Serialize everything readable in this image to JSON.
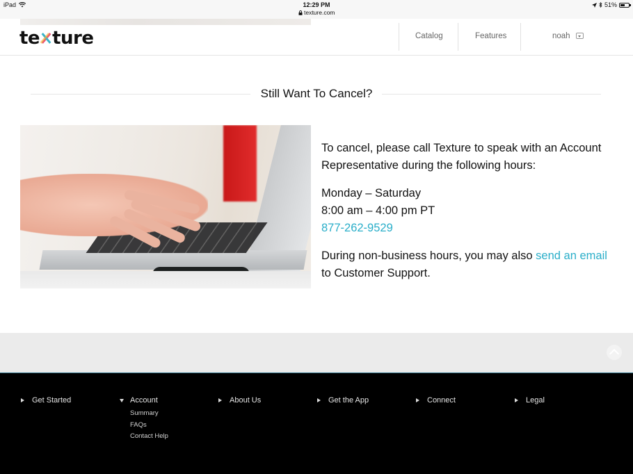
{
  "status_bar": {
    "device": "iPad",
    "time": "12:29 PM",
    "url": "texture.com",
    "battery": "51%",
    "icons": [
      "wifi-icon",
      "lock-icon",
      "location-arrow-icon",
      "bluetooth-icon",
      "battery-icon"
    ]
  },
  "header": {
    "logo_text": {
      "pre": "te",
      "post": "ture"
    },
    "nav": [
      {
        "label": "Catalog"
      },
      {
        "label": "Features"
      }
    ],
    "user": {
      "label": "noah"
    }
  },
  "section": {
    "title": "Still Want To Cancel?"
  },
  "photo": {
    "icon": "laptop-typing-photo"
  },
  "content": {
    "intro": "To cancel, please call Texture to speak with an Account Representative during the following hours:",
    "days": "Monday – Saturday",
    "hours": "8:00 am – 4:00 pm PT",
    "phone": "877-262-9529",
    "note_pre": "During non-business hours, you may also ",
    "note_link": "send an email",
    "note_post": " to Customer Support."
  },
  "footer": {
    "columns": [
      {
        "label": "Get Started",
        "expanded": false,
        "items": []
      },
      {
        "label": "Account",
        "expanded": true,
        "items": [
          "Summary",
          "FAQs",
          "Contact Help"
        ]
      },
      {
        "label": "About Us",
        "expanded": false,
        "items": []
      },
      {
        "label": "Get the App",
        "expanded": false,
        "items": []
      },
      {
        "label": "Connect",
        "expanded": false,
        "items": []
      },
      {
        "label": "Legal",
        "expanded": false,
        "items": []
      }
    ]
  },
  "colors": {
    "accent": "#2aaec9",
    "footer_bg": "#000000",
    "band_bg": "#ebebeb"
  }
}
